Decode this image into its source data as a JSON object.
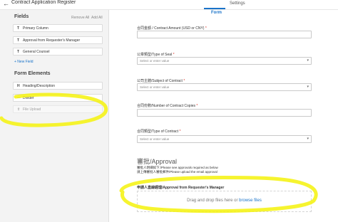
{
  "header": {
    "back_glyph": "←",
    "title": "Contract Application Register",
    "tabs": [
      {
        "label": "Form",
        "active": true
      },
      {
        "label": "Settings",
        "active": false
      }
    ],
    "accent_color": "#1a73c9"
  },
  "sidebar": {
    "fields_title": "Fields",
    "remove_all": "Remove All",
    "add_all": "Add All",
    "fields": [
      {
        "icon": "text-field-icon",
        "glyph": "T",
        "label": "Primary Column"
      },
      {
        "icon": "text-field-icon",
        "glyph": "T",
        "label": "Approval from Requester's Manager"
      },
      {
        "icon": "text-field-icon",
        "glyph": "T",
        "label": "General Counsel"
      }
    ],
    "new_field": "+ New Field",
    "elements_title": "Form Elements",
    "elements": [
      {
        "icon": "heading-icon",
        "glyph": "H",
        "label": "Heading/Description"
      },
      {
        "icon": "divider-icon",
        "glyph": "—",
        "label": "Divider"
      },
      {
        "icon": "file-upload-icon",
        "glyph": "⇧",
        "label": "File Upload"
      }
    ]
  },
  "form": {
    "q_amount": "合同金額 / Contract Amount (USD or CNY)",
    "q_seal": "公章類型/Type of Seal",
    "q_subject": "公司主體/Subject of Contract",
    "q_copies": "合同份數/Number of Contract Copies",
    "q_type": "合同類型/Type of Contract",
    "required_mark": "*",
    "select_placeholder": "Select or enter value",
    "approval_title": "審批/Approval",
    "approval_desc_1": "審批人明細如下:/Please see approvals required as below",
    "approval_desc_2": "請上傳審批人審批郵件/Please upload the email approval",
    "upload_label": "申請人直線經理/Approval from Requester's Manager",
    "drop_text": "Drag and drop files here or ",
    "browse_text": "browse files",
    "chevron_icon": "chevron-down-icon"
  },
  "annotation_color": "#f5f20a"
}
